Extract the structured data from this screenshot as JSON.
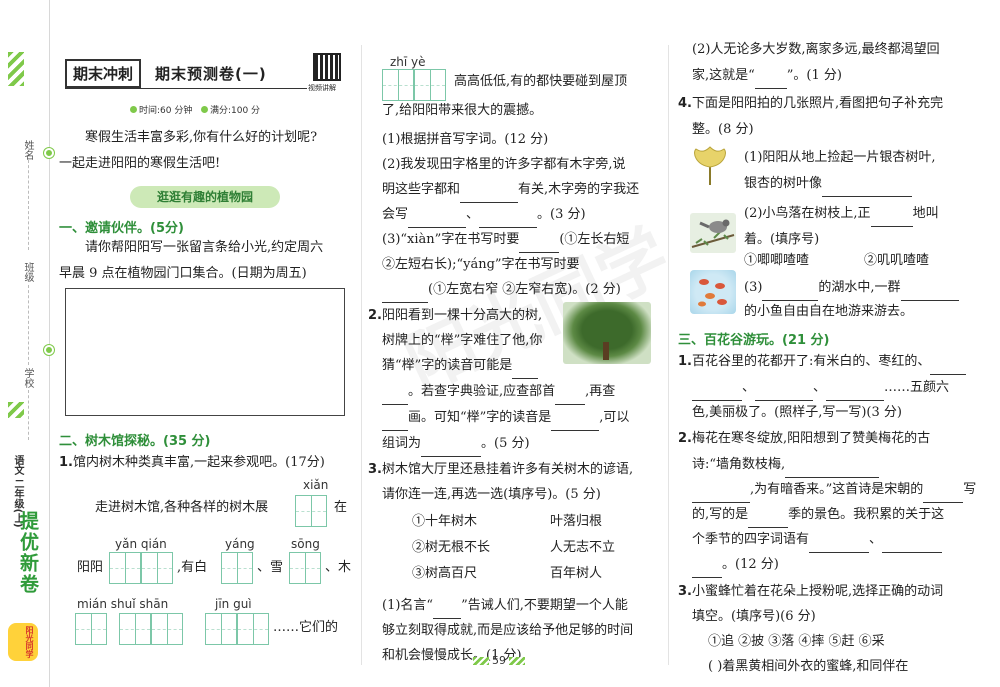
{
  "strip": {
    "name_label": "姓名",
    "class_label": "班级",
    "school_label": "学校",
    "series": "二年级(上)",
    "subject": "语文",
    "brand": "提优新卷",
    "logo": "阳光同学"
  },
  "header": {
    "tag": "期末冲刺",
    "title": "期末预测卷(一)",
    "qr_caption": "视频讲解",
    "time": "时间:60 分钟",
    "score": "满分:100 分"
  },
  "intro": {
    "line1": "寒假生活丰富多彩,你有什么好的计划呢?",
    "line2": "一起走进阳阳的寒假生活吧!"
  },
  "banner": "逛逛有趣的植物园",
  "s1": {
    "title": "一、邀请伙伴。(5分)",
    "line1": "请你帮阳阳写一张留言条给小光,约定周六",
    "line2": "早晨 9 点在植物园门口集合。(日期为周五)"
  },
  "s2": {
    "title": "二、树木馆探秘。(35 分)",
    "q1": "1.",
    "q1_text": "馆内树木种类真丰富,一起来参观吧。(17分)",
    "py_xian": "xiǎn",
    "line_a": "走进树木馆,各种各样的树木展",
    "line_a_end": "在",
    "py_yan_qian": "yǎn  qián",
    "py_yang": "yáng",
    "py_song": "sōng",
    "line_b1": "阳阳",
    "line_b2": ",有白",
    "line_b3": "、雪",
    "line_b4": "、木",
    "py_mian_shui_shan": "mián    shuǐ  shān",
    "py_jin_gui": "jīn    guì",
    "line_c_end": "……它们的"
  },
  "col2": {
    "py_zhi_ye": "zhī    yè",
    "line1": "高高低低,有的都快要碰到屋顶",
    "line2": "了,给阳阳带来很大的震撼。",
    "sub1": "(1)根据拼音写字词。(12 分)",
    "sub2a": "(2)我发现田字格里的许多字都有木字旁,说",
    "sub2b": "明这些字都和",
    "sub2b_end": "有关,木字旁的字我还",
    "sub2c": "会写",
    "sub2c_end": "。(3 分)",
    "sub3a": "(3)“xiàn”字在书写时要",
    "sub3a_end": "(①左长右短",
    "sub3b": "②左短右长);“yáng”字在书写时要",
    "sub3c": "(①左宽右窄",
    "sub3c_end": "②左窄右宽)。(2 分)",
    "q2": "2.",
    "q2a": "阳阳看到一棵十分高大的树,",
    "q2b": "树牌上的“榉”字难住了他,你",
    "q2c": "猜“榉”字的读音可能是",
    "q2d": "。若查字典验证,应查部首",
    "q2d_end": ",再查",
    "q2e": "画。可知“榉”字的读音是",
    "q2e_end": ",可以",
    "q2f": "组词为",
    "q2f_end": "。(5 分)",
    "q3": "3.",
    "q3a": "树木馆大厅里还悬挂着许多有关树木的谚语,",
    "q3b": "请你连一连,再选一选(填序号)。(5 分)",
    "match_left": [
      "①十年树木",
      "②树无根不长",
      "③树高百尺"
    ],
    "match_right": [
      "叶落归根",
      "人无志不立",
      "百年树人"
    ],
    "q3c": "(1)名言“",
    "q3c_end": "”告诫人们,不要期望一个人能",
    "q3d": "够立刻取得成就,而是应该给予他足够的时间",
    "q3e": "和机会慢慢成长。(1 分)"
  },
  "col3": {
    "top1": "(2)人无论多大岁数,离家多远,最终都渴望回",
    "top2": "家,这就是“",
    "top2_end": "”。(1 分)",
    "q4": "4.",
    "q4a": "下面是阳阳拍的几张照片,看图把句子补充完",
    "q4b": "整。(8 分)",
    "p1a": "(1)阳阳从地上捡起一片银杏树叶,",
    "p1b": "银杏的树叶像",
    "p2a": "(2)小鸟落在树枝上,正",
    "p2a_end": "地叫",
    "p2b": "着。(填序号)",
    "p2c": "①唧唧喳喳",
    "p2d": "②叽叽喳喳",
    "p3a": "(3)",
    "p3a_mid": "的湖水中,一群",
    "p3b": "的小鱼自由自在地游来游去。",
    "s3_title": "三、百花谷游玩。(21 分)",
    "q1": "1.",
    "q1a": "百花谷里的花都开了:有米白的、枣红的、",
    "q1b_end": "……五颜六",
    "q1c": "色,美丽极了。(照样子,写一写)(3 分)",
    "q2": "2.",
    "q2a": "梅花在寒冬绽放,阳阳想到了赞美梅花的古",
    "q2b": "诗:“墙角数枝梅,",
    "q2c": ",为有暗香来。”这首诗是宋朝的",
    "q2c_end": "写",
    "q2d": "的,写的是",
    "q2d_end": "季的景色。我积累的关于这",
    "q2e": "个季节的四字词语有",
    "q2f_end": "。(12 分)",
    "q3": "3.",
    "q3a": "小蜜蜂忙着在花朵上授粉呢,选择正确的动词",
    "q3b": "填空。(填序号)(6 分)",
    "q3c": "①追  ②披  ③落  ④摔  ⑤赶  ⑥采",
    "q3d": "(      )着黑黄相间外衣的蜜蜂,和同伴在"
  },
  "page_number": "59",
  "watermark": "阳光同学"
}
